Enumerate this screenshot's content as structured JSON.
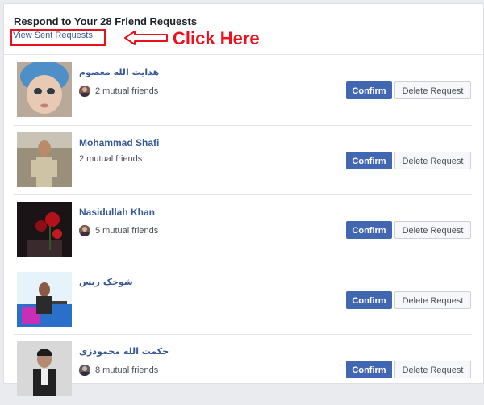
{
  "header": {
    "title": "Respond to Your 28 Friend Requests",
    "view_sent_label": "View Sent Requests",
    "annotation_label": "Click Here",
    "annotation_color": "#e8111d"
  },
  "buttons": {
    "confirm_label": "Confirm",
    "delete_label": "Delete Request"
  },
  "requests": [
    {
      "name": "هدايت الله معصوم",
      "mutual": "2 mutual friends"
    },
    {
      "name": "Mohammad Shafi",
      "mutual": "2 mutual friends"
    },
    {
      "name": "Nasidullah Khan",
      "mutual": "5 mutual friends"
    },
    {
      "name": "شوخک ریس",
      "mutual": ""
    },
    {
      "name": "حکمت الله محمودزی",
      "mutual": "8 mutual friends"
    }
  ],
  "colors": {
    "link": "#365899",
    "confirm_bg": "#4267b2",
    "delete_bg": "#f6f7f9"
  }
}
